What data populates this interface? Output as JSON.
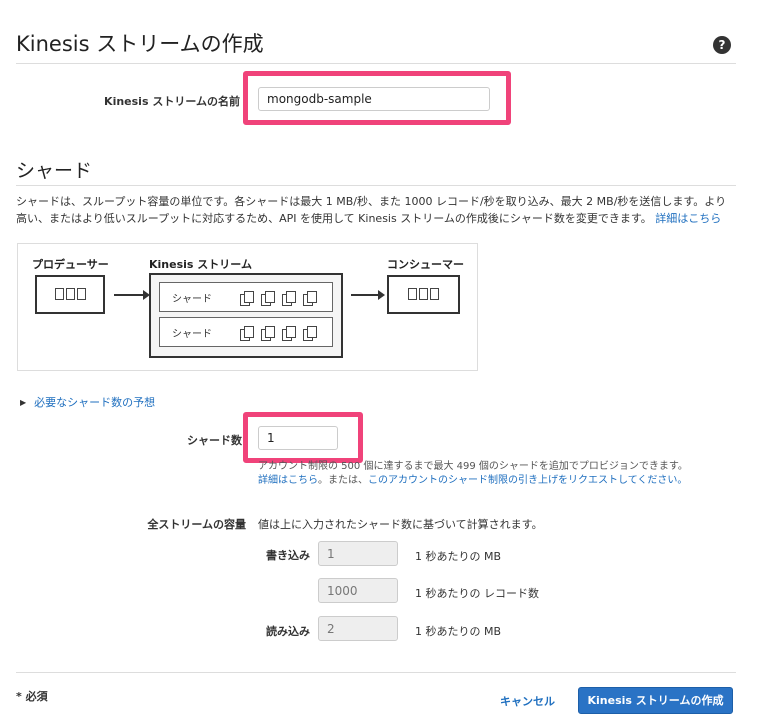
{
  "header": {
    "title": "Kinesis ストリームの作成",
    "help_icon": "?"
  },
  "name_field": {
    "label": "Kinesis ストリームの名前",
    "value": "mongodb-sample"
  },
  "shard_section": {
    "heading": "シャード",
    "description": "シャードは、スループット容量の単位です。各シャードは最大 1 MB/秒、また 1000 レコード/秒を取り込み、最大 2 MB/秒を送信します。より高い、またはより低いスループットに対応するため、API を使用して Kinesis ストリームの作成後にシャード数を変更できます。",
    "details_link": "詳細はこちら",
    "diagram": {
      "producer": "プロデューサー",
      "stream": "Kinesis ストリーム",
      "consumer": "コンシューマー",
      "shards": [
        "シャード",
        "シャード"
      ]
    },
    "estimate_toggle": "必要なシャード数の予想",
    "shard_count": {
      "label": "シャード数",
      "value": "1",
      "help": "アカウント制限の 500 個に達するまで最大 499 個のシャードを追加でプロビジョンできます。",
      "details_link": "詳細はこちら",
      "or_text": "。または、",
      "limit_link": "このアカウントのシャード制限の引き上げをリクエストしてください。"
    }
  },
  "capacity": {
    "label": "全ストリームの容量",
    "note": "値は上に入力されたシャード数に基づいて計算されます。",
    "write_label": "書き込み",
    "write_mb": "1",
    "write_mb_unit": "1 秒あたりの MB",
    "write_records": "1000",
    "write_records_unit": "1 秒あたりの レコード数",
    "read_label": "読み込み",
    "read_mb": "2",
    "read_mb_unit": "1 秒あたりの MB"
  },
  "footer": {
    "required": "* 必須",
    "cancel": "キャンセル",
    "create": "Kinesis ストリームの作成"
  }
}
